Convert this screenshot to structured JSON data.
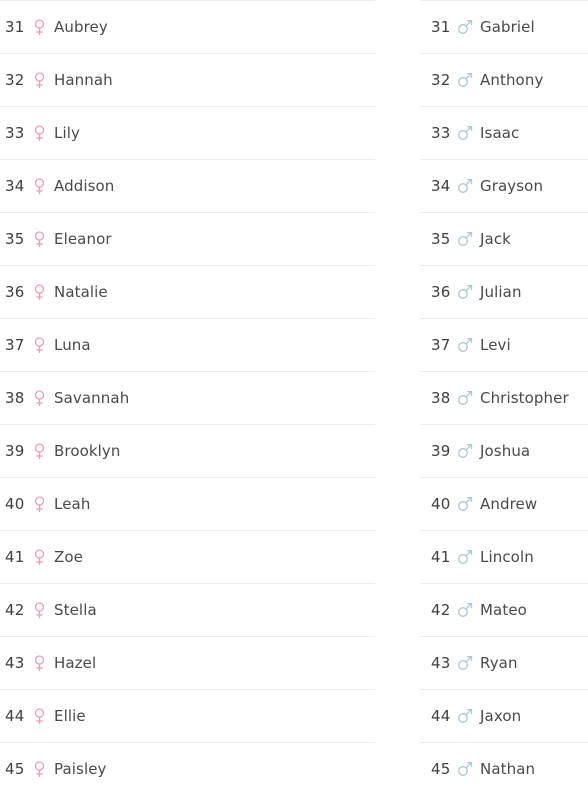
{
  "board": {
    "columns": [
      {
        "id": "girls",
        "gender": "female",
        "icon": "female-symbol-icon",
        "icon_color": "#f09bb4",
        "rows": [
          {
            "rank": "31",
            "name": "Aubrey"
          },
          {
            "rank": "32",
            "name": "Hannah"
          },
          {
            "rank": "33",
            "name": "Lily"
          },
          {
            "rank": "34",
            "name": "Addison"
          },
          {
            "rank": "35",
            "name": "Eleanor"
          },
          {
            "rank": "36",
            "name": "Natalie"
          },
          {
            "rank": "37",
            "name": "Luna"
          },
          {
            "rank": "38",
            "name": "Savannah"
          },
          {
            "rank": "39",
            "name": "Brooklyn"
          },
          {
            "rank": "40",
            "name": "Leah"
          },
          {
            "rank": "41",
            "name": "Zoe"
          },
          {
            "rank": "42",
            "name": "Stella"
          },
          {
            "rank": "43",
            "name": "Hazel"
          },
          {
            "rank": "44",
            "name": "Ellie"
          },
          {
            "rank": "45",
            "name": "Paisley"
          }
        ]
      },
      {
        "id": "boys",
        "gender": "male",
        "icon": "male-symbol-icon",
        "icon_color": "#a8c8d8",
        "rows": [
          {
            "rank": "31",
            "name": "Gabriel"
          },
          {
            "rank": "32",
            "name": "Anthony"
          },
          {
            "rank": "33",
            "name": "Isaac"
          },
          {
            "rank": "34",
            "name": "Grayson"
          },
          {
            "rank": "35",
            "name": "Jack"
          },
          {
            "rank": "36",
            "name": "Julian"
          },
          {
            "rank": "37",
            "name": "Levi"
          },
          {
            "rank": "38",
            "name": "Christopher"
          },
          {
            "rank": "39",
            "name": "Joshua"
          },
          {
            "rank": "40",
            "name": "Andrew"
          },
          {
            "rank": "41",
            "name": "Lincoln"
          },
          {
            "rank": "42",
            "name": "Mateo"
          },
          {
            "rank": "43",
            "name": "Ryan"
          },
          {
            "rank": "44",
            "name": "Jaxon"
          },
          {
            "rank": "45",
            "name": "Nathan"
          }
        ]
      }
    ]
  },
  "theme": {
    "divider_color": "#ececec",
    "text_color": "#4a4a4a",
    "rank_color": "#3f3f3f",
    "background": "#ffffff"
  }
}
